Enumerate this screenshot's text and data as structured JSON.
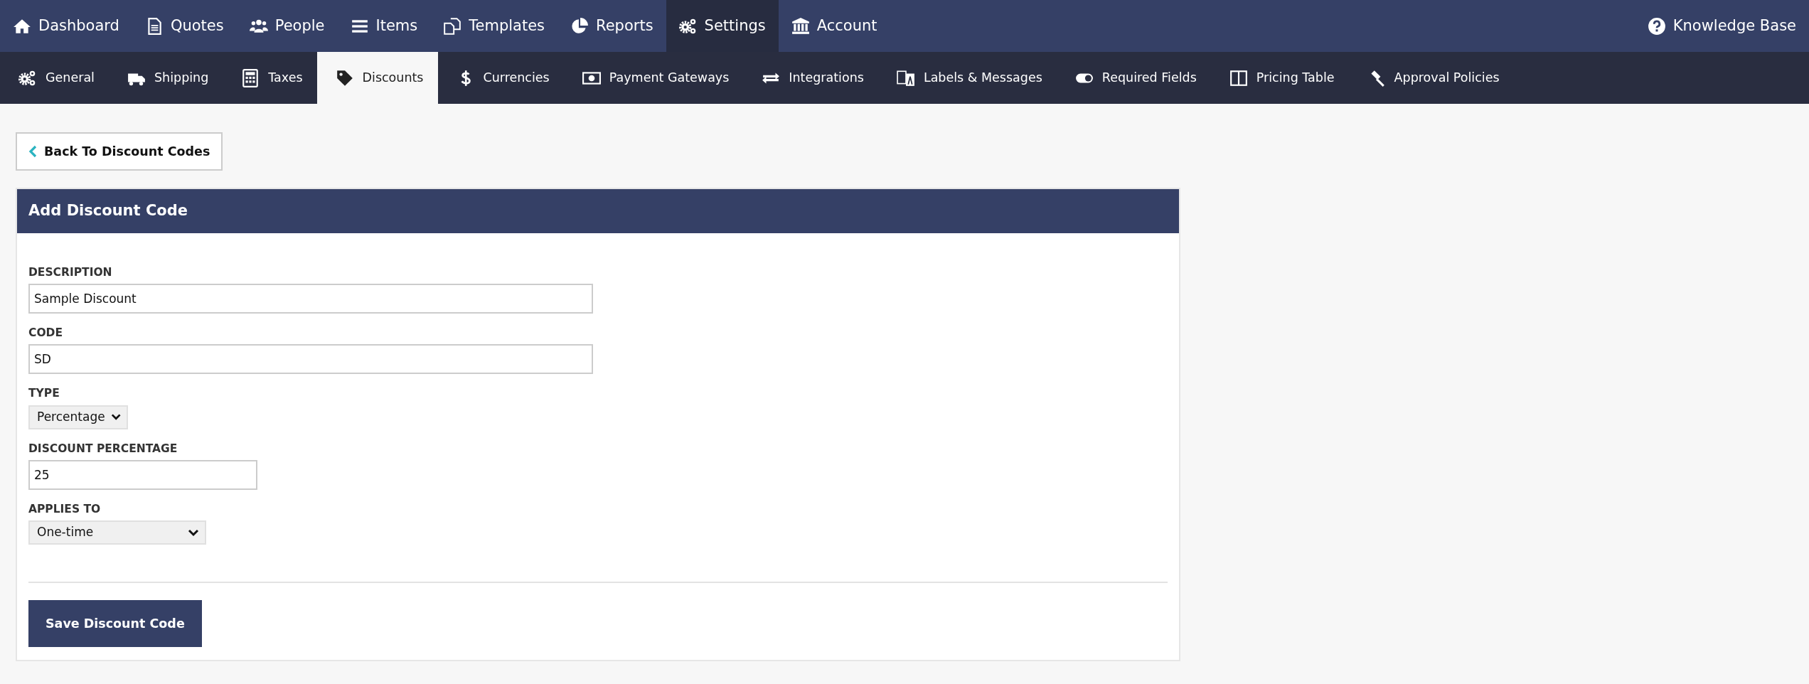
{
  "top_nav": {
    "items": [
      {
        "label": "Dashboard",
        "selected": false
      },
      {
        "label": "Quotes",
        "selected": false
      },
      {
        "label": "People",
        "selected": false
      },
      {
        "label": "Items",
        "selected": false
      },
      {
        "label": "Templates",
        "selected": false
      },
      {
        "label": "Reports",
        "selected": false
      },
      {
        "label": "Settings",
        "selected": true
      },
      {
        "label": "Account",
        "selected": false
      }
    ],
    "help_link": "Knowledge Base"
  },
  "settings_tabs": [
    {
      "label": "General",
      "selected": false
    },
    {
      "label": "Shipping",
      "selected": false
    },
    {
      "label": "Taxes",
      "selected": false
    },
    {
      "label": "Discounts",
      "selected": true
    },
    {
      "label": "Currencies",
      "selected": false
    },
    {
      "label": "Payment Gateways",
      "selected": false
    },
    {
      "label": "Integrations",
      "selected": false
    },
    {
      "label": "Labels & Messages",
      "selected": false
    },
    {
      "label": "Required Fields",
      "selected": false
    },
    {
      "label": "Pricing Table",
      "selected": false
    },
    {
      "label": "Approval Policies",
      "selected": false
    }
  ],
  "back_button": "Back To Discount Codes",
  "panel": {
    "title": "Add Discount Code",
    "fields": [
      {
        "kind": "text",
        "label": "DESCRIPTION",
        "value": "Sample Discount"
      },
      {
        "kind": "text",
        "label": "CODE",
        "value": "SD"
      },
      {
        "kind": "select",
        "label": "TYPE",
        "value": "Percentage"
      },
      {
        "kind": "text",
        "label": "DISCOUNT PERCENTAGE",
        "value": "25"
      },
      {
        "kind": "select",
        "label": "APPLIES TO",
        "value": "One-time"
      }
    ],
    "save_button": "Save Discount Code"
  }
}
